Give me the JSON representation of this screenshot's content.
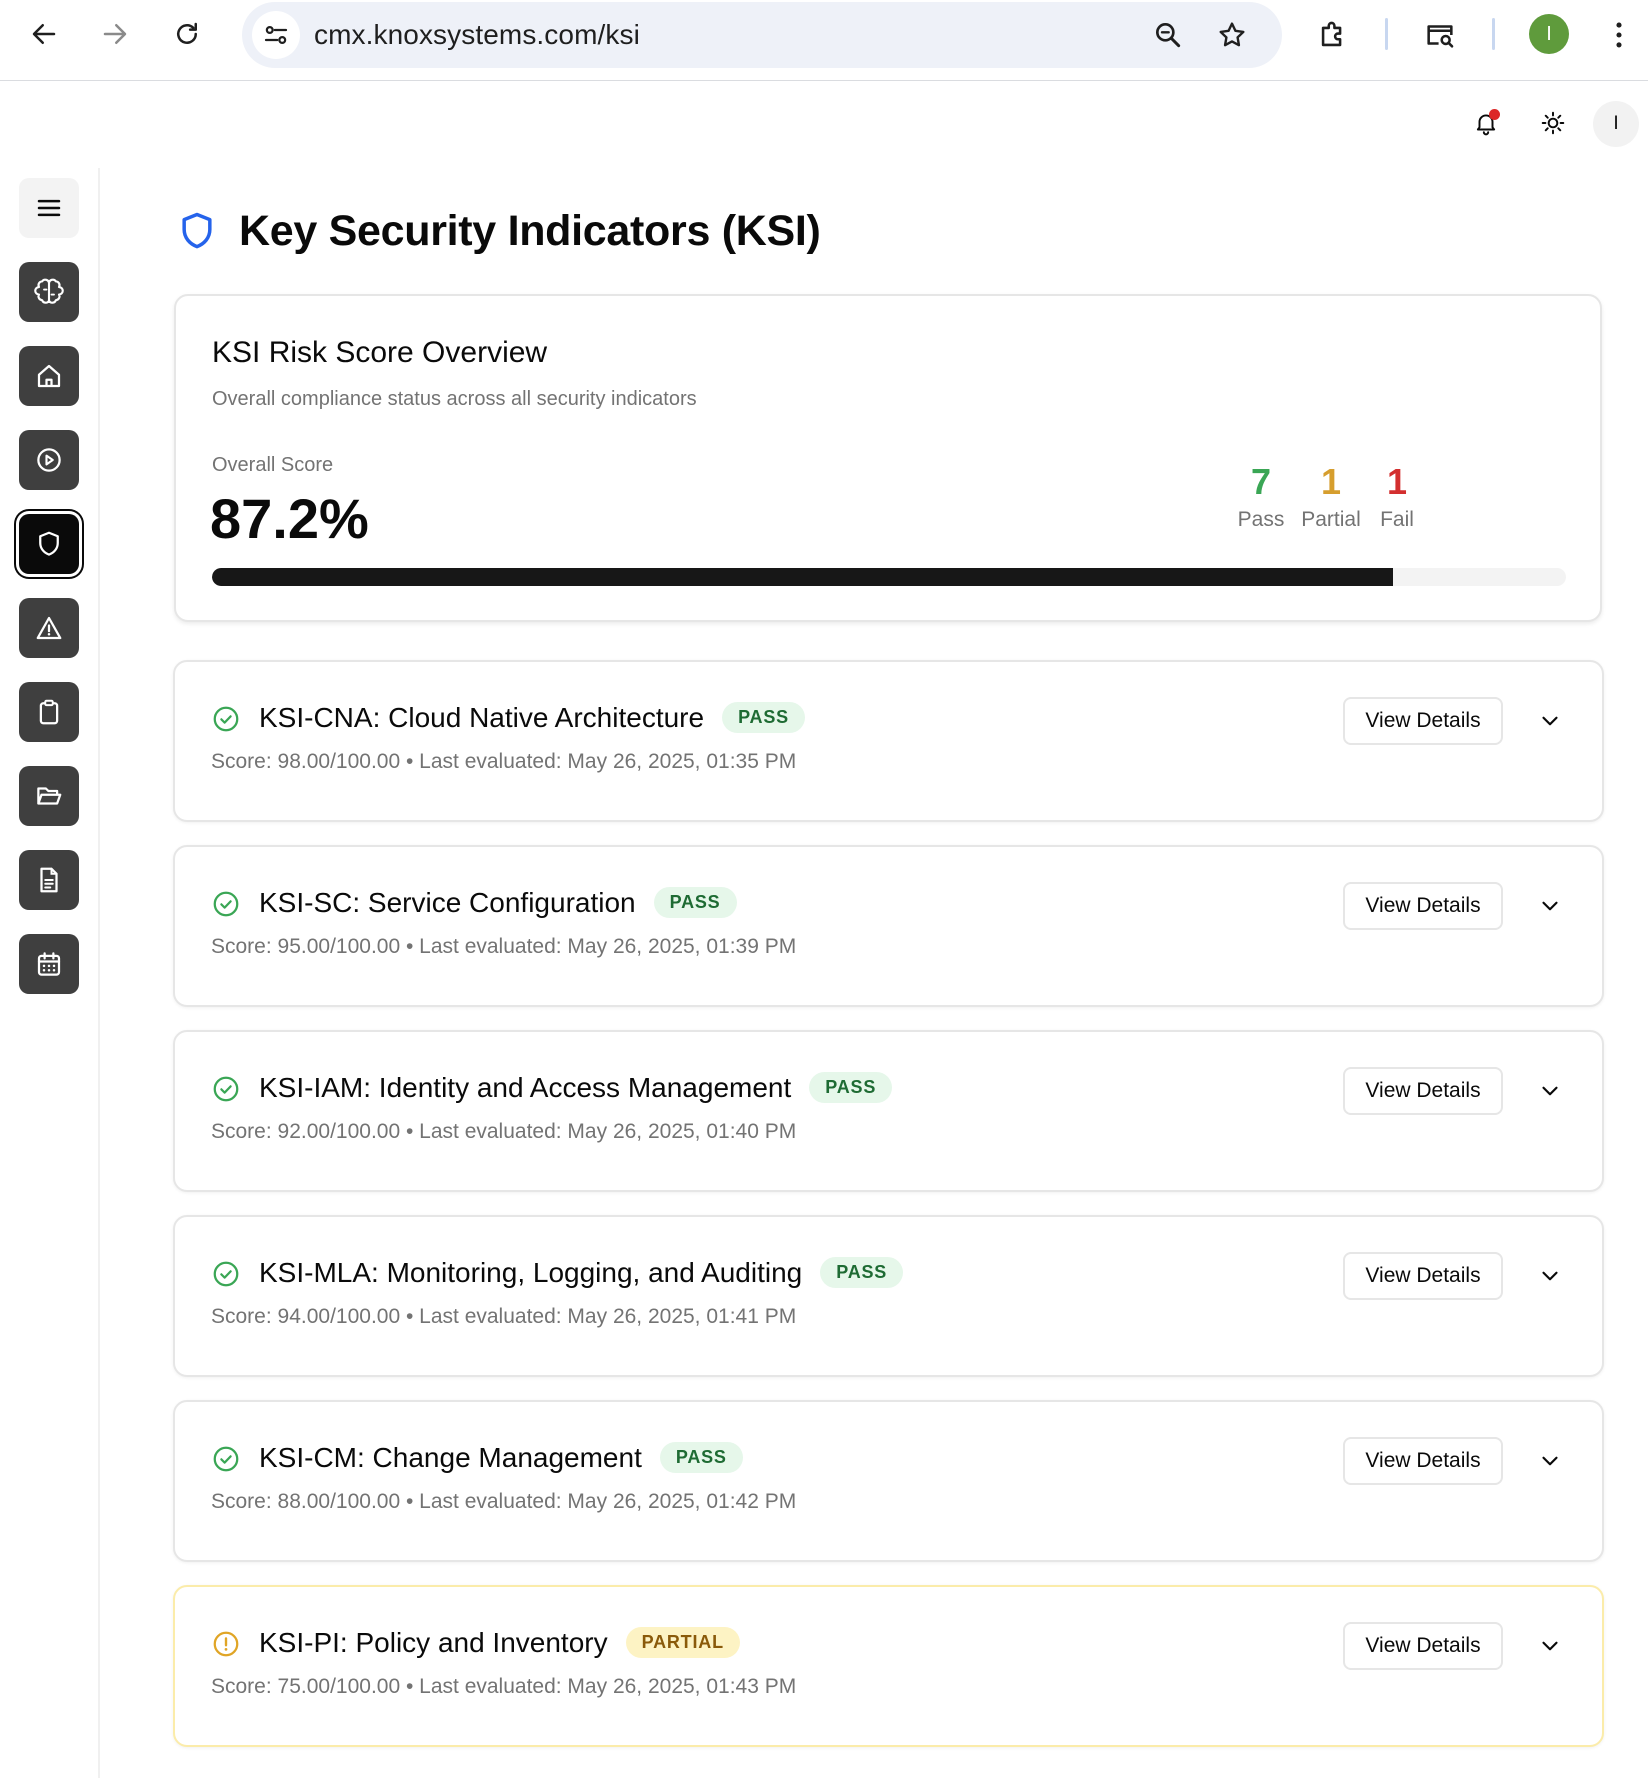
{
  "browser": {
    "url": "cmx.knoxsystems.com/ksi",
    "profile_initial": "I"
  },
  "header": {
    "user_initial": "I",
    "has_notification": true
  },
  "sidebar": {
    "items": [
      {
        "icon": "menu-icon"
      },
      {
        "icon": "brain-icon"
      },
      {
        "icon": "home-icon"
      },
      {
        "icon": "play-circle-icon"
      },
      {
        "icon": "shield-icon",
        "active": true
      },
      {
        "icon": "alert-triangle-icon"
      },
      {
        "icon": "clipboard-icon"
      },
      {
        "icon": "folder-open-icon"
      },
      {
        "icon": "file-text-icon"
      },
      {
        "icon": "calendar-icon"
      }
    ]
  },
  "page": {
    "title": "Key Security Indicators (KSI)"
  },
  "overview": {
    "title": "KSI Risk Score Overview",
    "subtitle": "Overall compliance status across all security indicators",
    "score_label": "Overall Score",
    "score": "87.2%",
    "score_value": 0.872,
    "pass_count": "7",
    "pass_label": "Pass",
    "partial_count": "1",
    "partial_label": "Partial",
    "fail_count": "1",
    "fail_label": "Fail"
  },
  "colors": {
    "pass": "#3aa655",
    "partial": "#d69e2e",
    "fail": "#d32f2f",
    "progress": "#171717"
  },
  "ksi_list": [
    {
      "title": "KSI-CNA: Cloud Native Architecture",
      "status": "PASS",
      "meta": "Score: 98.00/100.00 • Last evaluated: May 26, 2025, 01:35 PM",
      "button": "View Details"
    },
    {
      "title": "KSI-SC: Service Configuration",
      "status": "PASS",
      "meta": "Score: 95.00/100.00 • Last evaluated: May 26, 2025, 01:39 PM",
      "button": "View Details"
    },
    {
      "title": "KSI-IAM: Identity and Access Management",
      "status": "PASS",
      "meta": "Score: 92.00/100.00 • Last evaluated: May 26, 2025, 01:40 PM",
      "button": "View Details"
    },
    {
      "title": "KSI-MLA: Monitoring, Logging, and Auditing",
      "status": "PASS",
      "meta": "Score: 94.00/100.00 • Last evaluated: May 26, 2025, 01:41 PM",
      "button": "View Details"
    },
    {
      "title": "KSI-CM: Change Management",
      "status": "PASS",
      "meta": "Score: 88.00/100.00 • Last evaluated: May 26, 2025, 01:42 PM",
      "button": "View Details"
    },
    {
      "title": "KSI-PI: Policy and Inventory",
      "status": "PARTIAL",
      "meta": "Score: 75.00/100.00 • Last evaluated: May 26, 2025, 01:43 PM",
      "button": "View Details"
    }
  ]
}
